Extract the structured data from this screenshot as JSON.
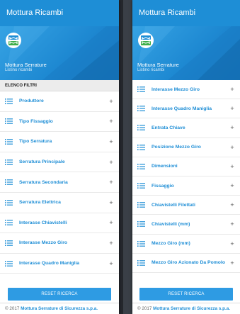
{
  "app": {
    "title": "Mottura Ricambi",
    "brand_color": "#1e8ed6"
  },
  "drawer": {
    "title": "Mottura Serrature",
    "subtitle": "Listino ricambi",
    "logo_text": "M"
  },
  "left_panel": {
    "section_title": "ELENCO FILTRI",
    "items": [
      {
        "label": "Produttore"
      },
      {
        "label": "Tipo Fissaggio"
      },
      {
        "label": "Tipo Serratura"
      },
      {
        "label": "Serratura Principale"
      },
      {
        "label": "Serratura Secondaria"
      },
      {
        "label": "Serratura Elettrica"
      },
      {
        "label": "Interasse Chiavistelli"
      },
      {
        "label": "Interasse Mezzo Giro"
      },
      {
        "label": "Interasse Quadro Maniglia"
      }
    ]
  },
  "right_panel": {
    "items": [
      {
        "label": "Interasse Mezzo Giro"
      },
      {
        "label": "Interasse Quadro Maniglia"
      },
      {
        "label": "Entrata Chiave"
      },
      {
        "label": "Posizione Mezzo Giro"
      },
      {
        "label": "Dimensioni"
      },
      {
        "label": "Fissaggio"
      },
      {
        "label": "Chiavistelli Filettati"
      },
      {
        "label": "Chiavistelli (mm)"
      },
      {
        "label": "Mezzo Giro (mm)"
      },
      {
        "label": "Mezzo Giro Azionato Da Pomolo"
      }
    ]
  },
  "expand_symbol": "+",
  "reset_label": "RESET RICERCA",
  "footer": {
    "prefix": "© 2017",
    "company": "Mottura Serrature di Sicurezza s.p.a."
  }
}
